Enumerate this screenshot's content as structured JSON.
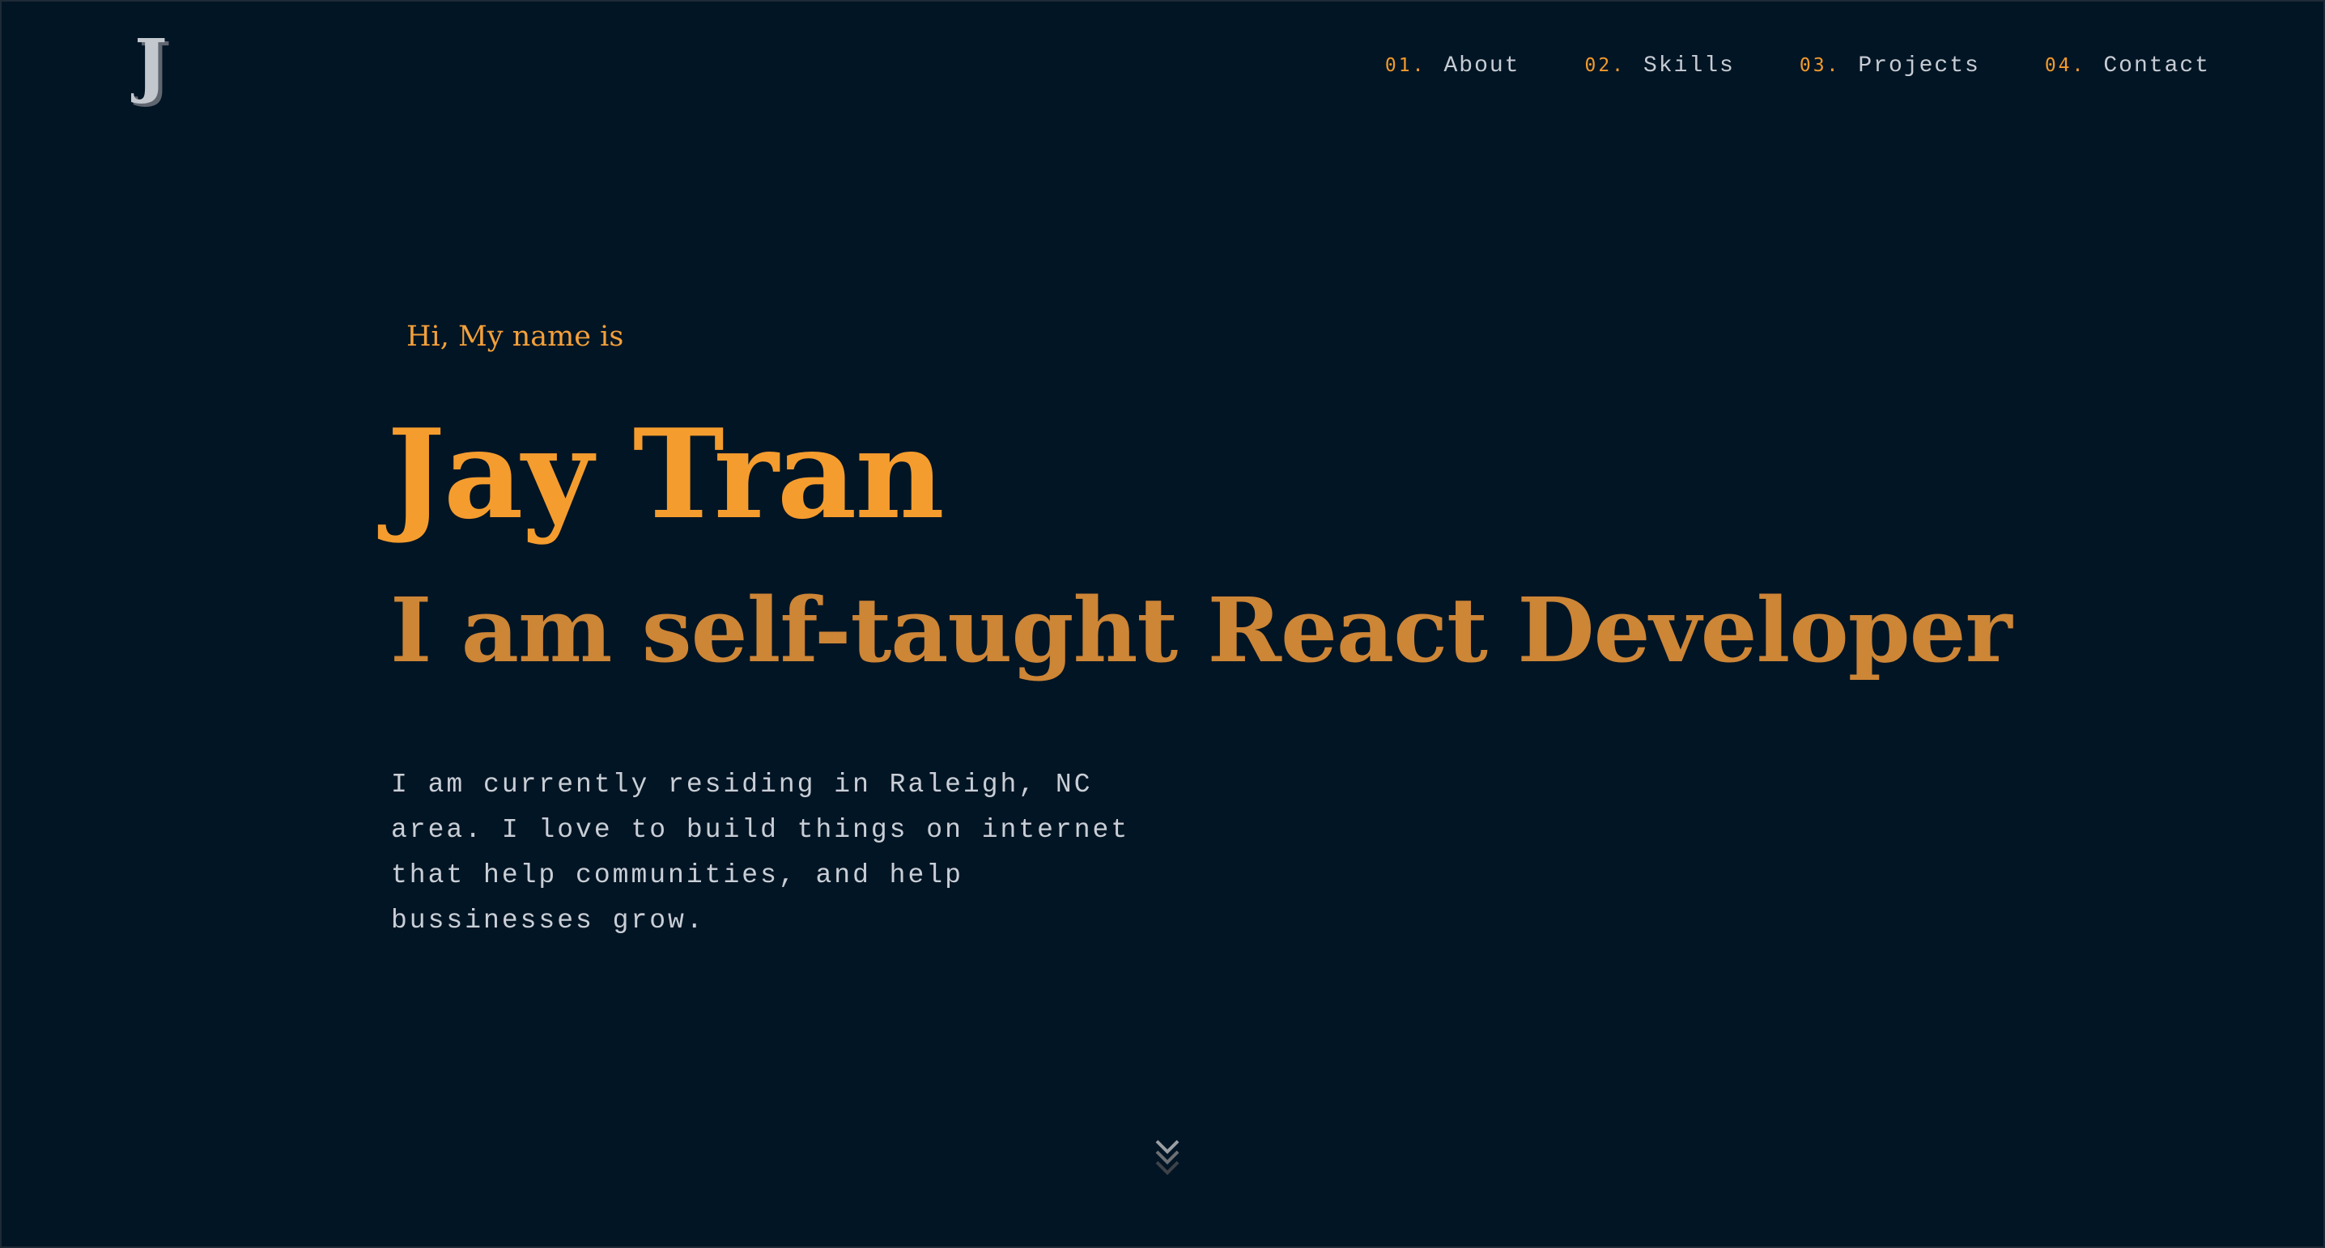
{
  "header": {
    "logo_letter": "J",
    "nav": [
      {
        "number": "01.",
        "label": "About"
      },
      {
        "number": "02.",
        "label": "Skills"
      },
      {
        "number": "03.",
        "label": "Projects"
      },
      {
        "number": "04.",
        "label": "Contact"
      }
    ]
  },
  "hero": {
    "greeting": "Hi, My name is",
    "name": "Jay Tran",
    "role": "I am self-taught React Developer",
    "bio": "I am currently residing in Raleigh, NC area. I love to build things on internet that help communities, and help bussinesses grow."
  },
  "icons": {
    "logo": "letter-j-logo-icon",
    "scroll": "double-chevron-down-icon"
  },
  "colors": {
    "background": "#021524",
    "accent": "#f59c2e",
    "accent_muted": "#cd8536",
    "text": "#c9ced6"
  }
}
